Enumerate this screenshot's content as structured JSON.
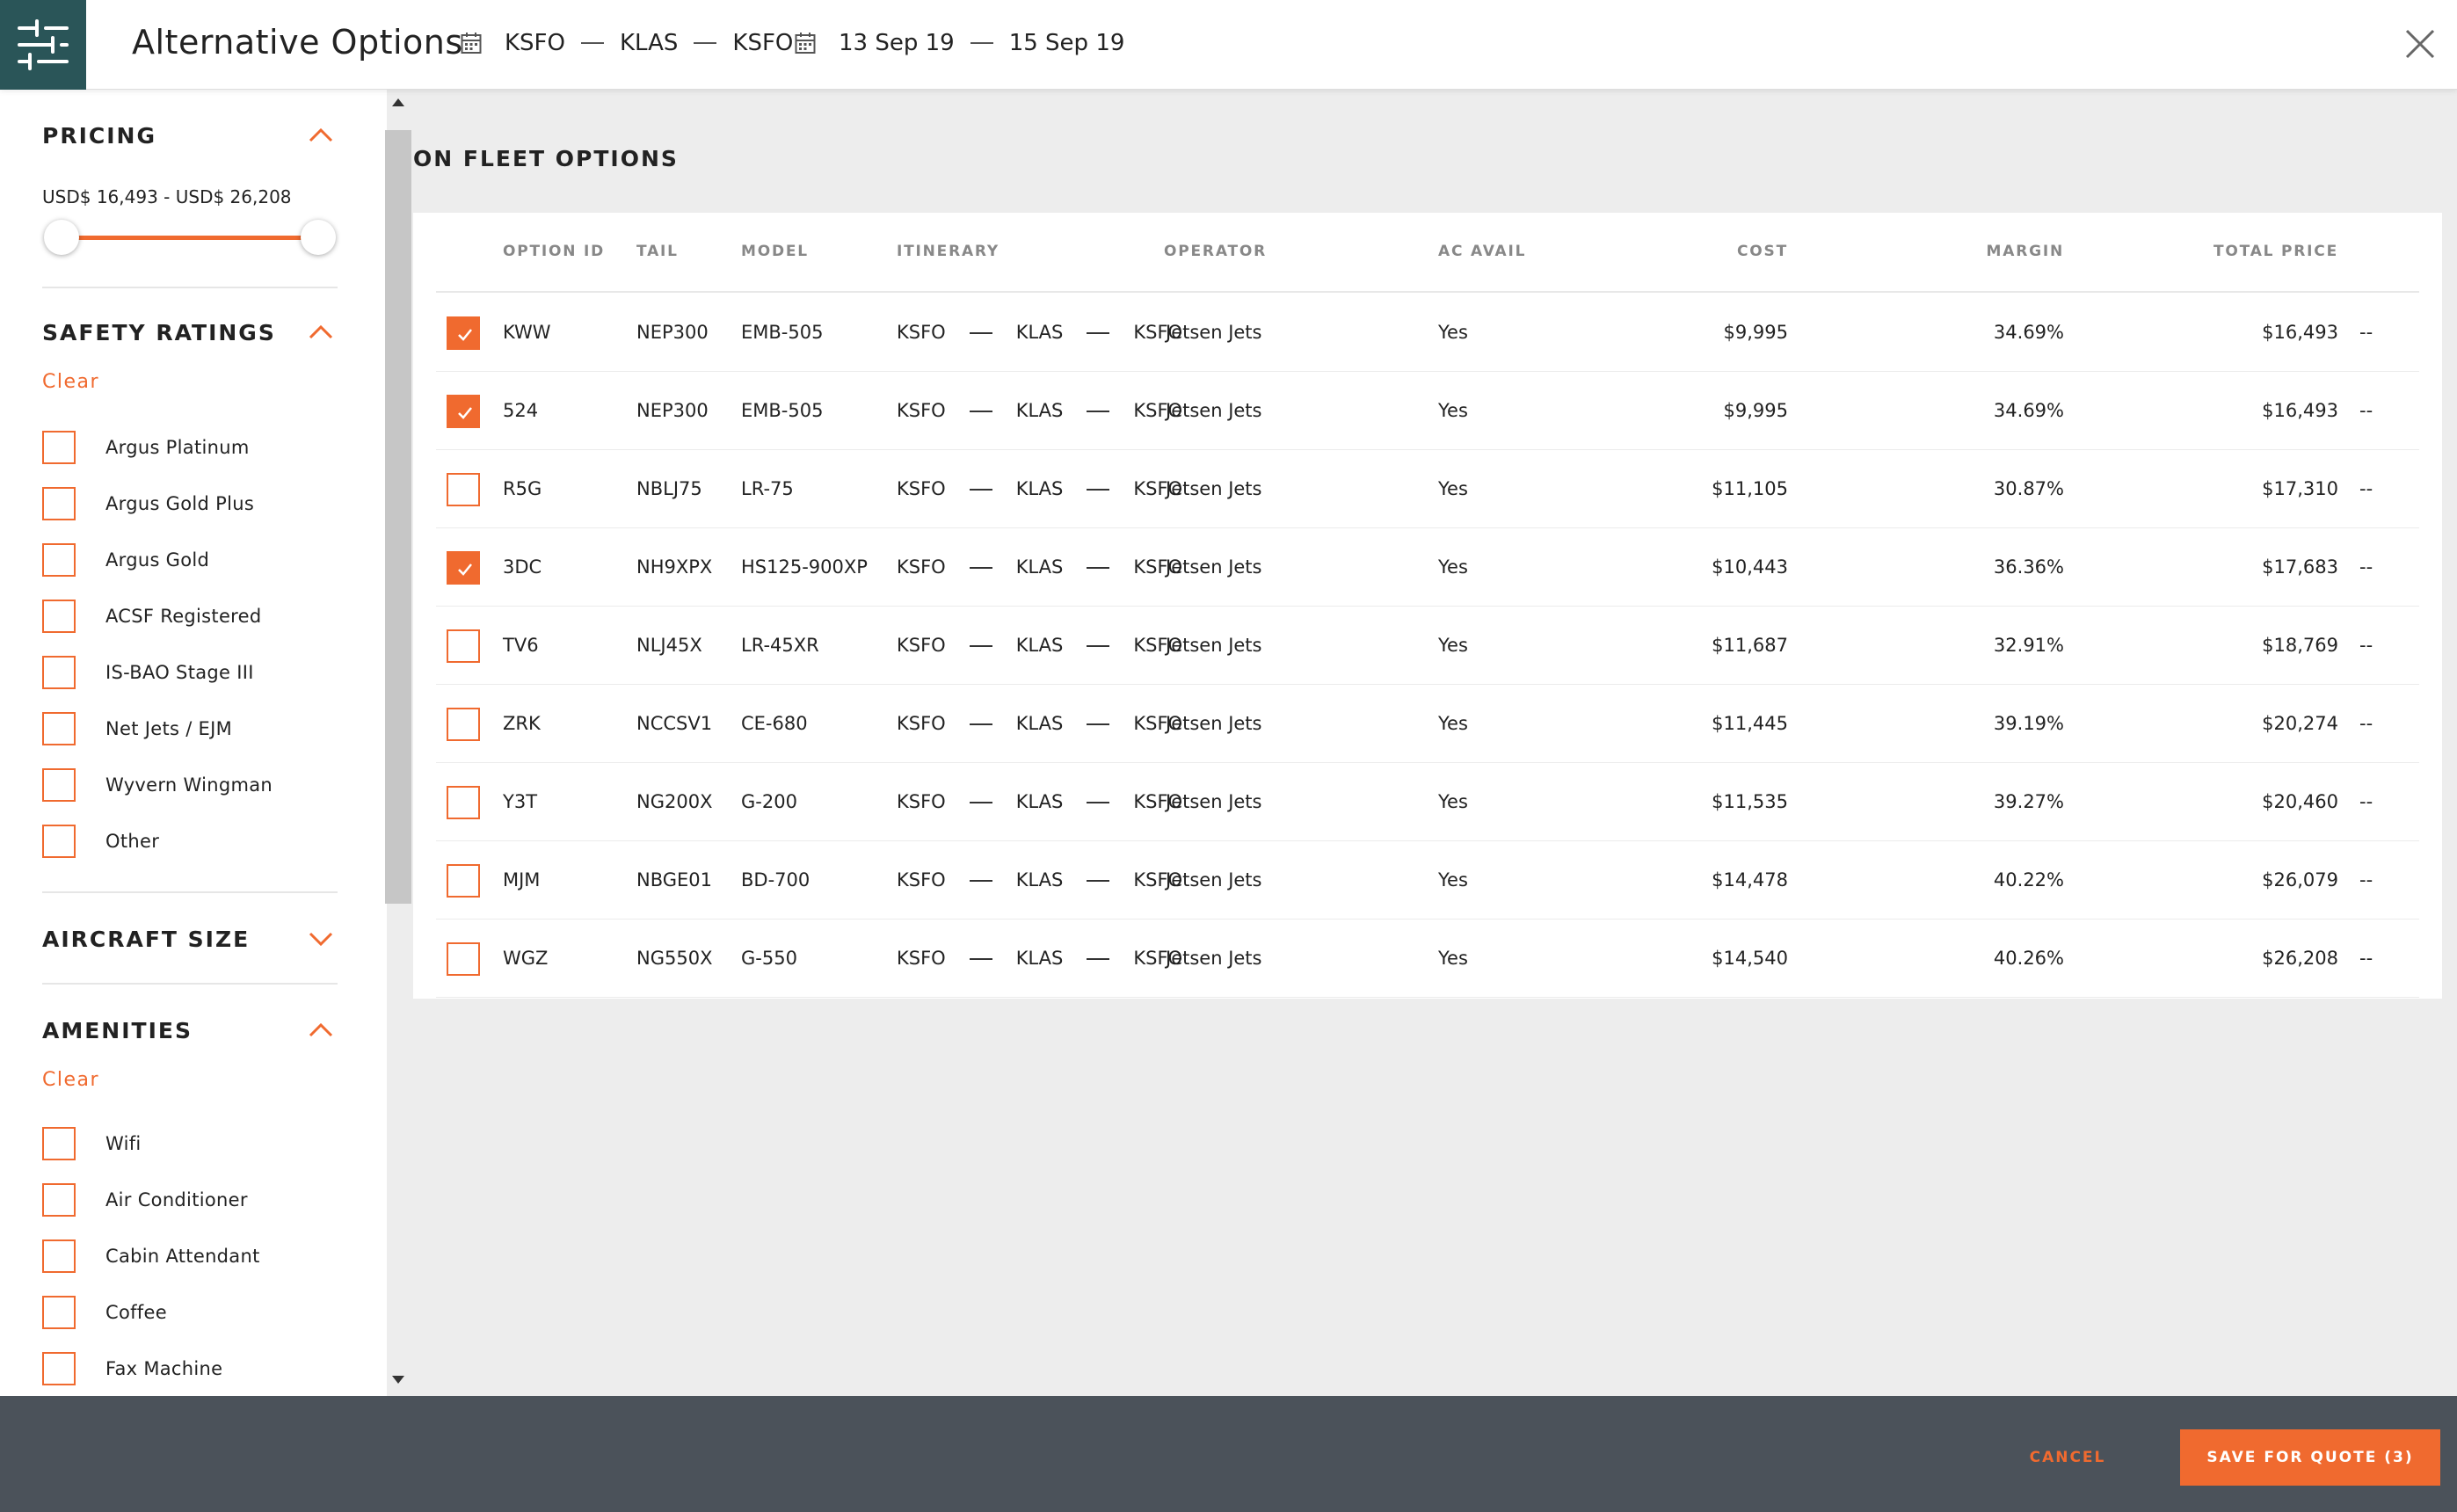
{
  "header": {
    "title": "Alternative Options",
    "route": [
      "KSFO",
      "KLAS",
      "KSFO"
    ],
    "dates": [
      "13 Sep 19",
      "15 Sep 19"
    ]
  },
  "sidebar": {
    "pricing": {
      "title": "PRICING",
      "range_label": "USD$ 16,493 - USD$ 26,208"
    },
    "safety": {
      "title": "SAFETY RATINGS",
      "clear": "Clear",
      "options": [
        "Argus Platinum",
        "Argus Gold Plus",
        "Argus Gold",
        "ACSF Registered",
        "IS-BAO Stage III",
        "Net Jets / EJM",
        "Wyvern Wingman",
        "Other"
      ]
    },
    "aircraft_size": {
      "title": "AIRCRAFT SIZE"
    },
    "amenities": {
      "title": "AMENITIES",
      "clear": "Clear",
      "options": [
        "Wifi",
        "Air Conditioner",
        "Cabin Attendant",
        "Coffee",
        "Fax Machine"
      ]
    }
  },
  "main": {
    "title": "ON FLEET OPTIONS",
    "columns": {
      "option_id": "OPTION ID",
      "tail": "TAIL",
      "model": "MODEL",
      "itinerary": "ITINERARY",
      "operator": "OPERATOR",
      "ac_avail": "AC AVAIL",
      "cost": "COST",
      "margin": "MARGIN",
      "total_price": "TOTAL PRICE"
    },
    "rows": [
      {
        "checked": true,
        "option_id": "KWW",
        "tail": "NEP300",
        "model": "EMB-505",
        "itinerary": [
          "KSFO",
          "KLAS",
          "KSFO"
        ],
        "operator": "Jetsen Jets",
        "ac_avail": "Yes",
        "cost": "$9,995",
        "margin": "34.69%",
        "total_price": "$16,493",
        "extra": "--"
      },
      {
        "checked": true,
        "option_id": "524",
        "tail": "NEP300",
        "model": "EMB-505",
        "itinerary": [
          "KSFO",
          "KLAS",
          "KSFO"
        ],
        "operator": "Jetsen Jets",
        "ac_avail": "Yes",
        "cost": "$9,995",
        "margin": "34.69%",
        "total_price": "$16,493",
        "extra": "--"
      },
      {
        "checked": false,
        "option_id": "R5G",
        "tail": "NBLJ75",
        "model": "LR-75",
        "itinerary": [
          "KSFO",
          "KLAS",
          "KSFO"
        ],
        "operator": "Jetsen Jets",
        "ac_avail": "Yes",
        "cost": "$11,105",
        "margin": "30.87%",
        "total_price": "$17,310",
        "extra": "--"
      },
      {
        "checked": true,
        "option_id": "3DC",
        "tail": "NH9XPX",
        "model": "HS125-900XP",
        "itinerary": [
          "KSFO",
          "KLAS",
          "KSFO"
        ],
        "operator": "Jetsen Jets",
        "ac_avail": "Yes",
        "cost": "$10,443",
        "margin": "36.36%",
        "total_price": "$17,683",
        "extra": "--"
      },
      {
        "checked": false,
        "option_id": "TV6",
        "tail": "NLJ45X",
        "model": "LR-45XR",
        "itinerary": [
          "KSFO",
          "KLAS",
          "KSFO"
        ],
        "operator": "Jetsen Jets",
        "ac_avail": "Yes",
        "cost": "$11,687",
        "margin": "32.91%",
        "total_price": "$18,769",
        "extra": "--"
      },
      {
        "checked": false,
        "option_id": "ZRK",
        "tail": "NCCSV1",
        "model": "CE-680",
        "itinerary": [
          "KSFO",
          "KLAS",
          "KSFO"
        ],
        "operator": "Jetsen Jets",
        "ac_avail": "Yes",
        "cost": "$11,445",
        "margin": "39.19%",
        "total_price": "$20,274",
        "extra": "--"
      },
      {
        "checked": false,
        "option_id": "Y3T",
        "tail": "NG200X",
        "model": "G-200",
        "itinerary": [
          "KSFO",
          "KLAS",
          "KSFO"
        ],
        "operator": "Jetsen Jets",
        "ac_avail": "Yes",
        "cost": "$11,535",
        "margin": "39.27%",
        "total_price": "$20,460",
        "extra": "--"
      },
      {
        "checked": false,
        "option_id": "MJM",
        "tail": "NBGE01",
        "model": "BD-700",
        "itinerary": [
          "KSFO",
          "KLAS",
          "KSFO"
        ],
        "operator": "Jetsen Jets",
        "ac_avail": "Yes",
        "cost": "$14,478",
        "margin": "40.22%",
        "total_price": "$26,079",
        "extra": "--"
      },
      {
        "checked": false,
        "option_id": "WGZ",
        "tail": "NG550X",
        "model": "G-550",
        "itinerary": [
          "KSFO",
          "KLAS",
          "KSFO"
        ],
        "operator": "Jetsen Jets",
        "ac_avail": "Yes",
        "cost": "$14,540",
        "margin": "40.26%",
        "total_price": "$26,208",
        "extra": "--"
      }
    ]
  },
  "footer": {
    "cancel_label": "CANCEL",
    "save_label": "SAVE FOR QUOTE (3)"
  },
  "colors": {
    "accent": "#f06a2f",
    "brand_dark": "#2a5558",
    "footer_bg": "#4b525a"
  }
}
